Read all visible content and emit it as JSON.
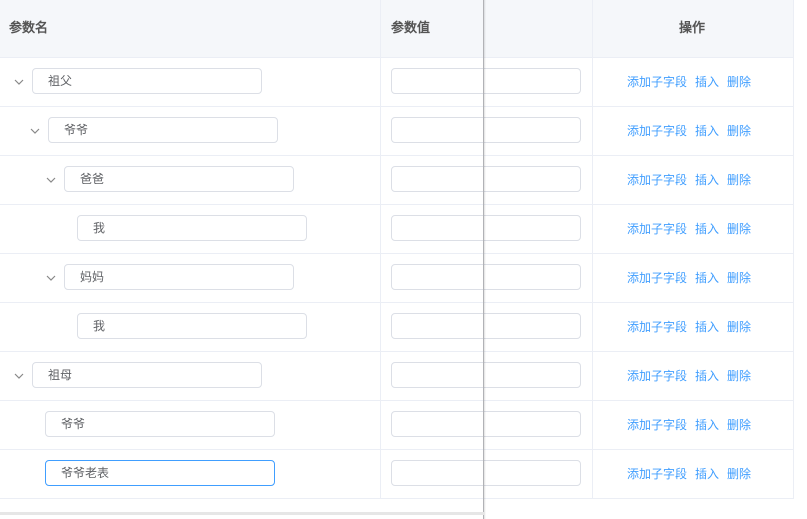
{
  "header": {
    "param_name": "参数名",
    "param_value": "参数值",
    "operations": "操作"
  },
  "actions": {
    "add_child": "添加子字段",
    "insert": "插入",
    "delete": "删除"
  },
  "rows": [
    {
      "name": "祖父",
      "level": 0,
      "expanded": true
    },
    {
      "name": "爷爷",
      "level": 1,
      "expanded": true
    },
    {
      "name": "爸爸",
      "level": 2,
      "expanded": true
    },
    {
      "name": "我",
      "level": 3,
      "expanded": false
    },
    {
      "name": "妈妈",
      "level": 2,
      "expanded": true
    },
    {
      "name": "我",
      "level": 3,
      "expanded": false
    },
    {
      "name": "祖母",
      "level": 0,
      "expanded": true
    },
    {
      "name": "爷爷",
      "level": 1,
      "expanded": false
    },
    {
      "name": "爷爷老表",
      "level": 1,
      "expanded": false,
      "focused": true
    }
  ],
  "colors": {
    "link": "#409eff",
    "border": "#ebeef5",
    "header_bg": "#f5f7fa",
    "focus": "#409eff"
  }
}
